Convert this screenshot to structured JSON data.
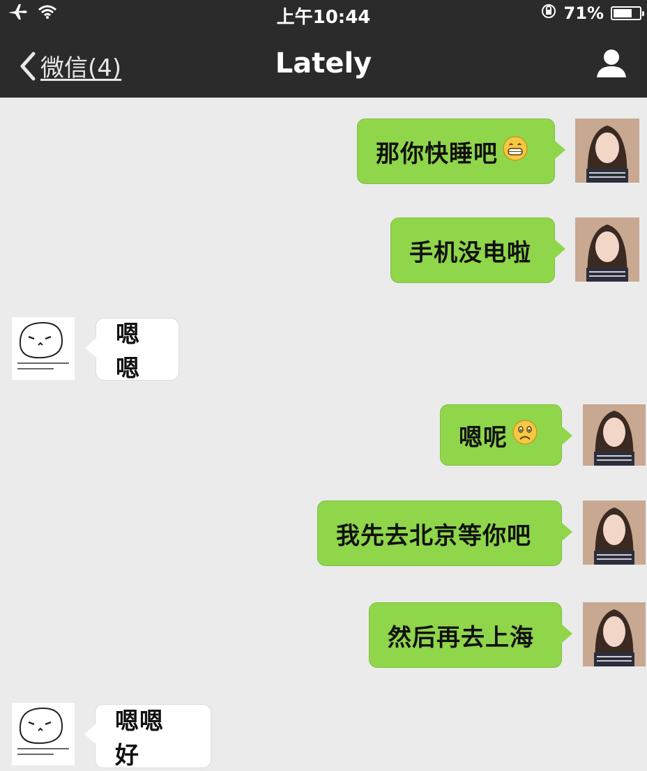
{
  "status_bar": {
    "time": "上午10:44",
    "battery_text": "71%",
    "battery_level": 0.71
  },
  "nav": {
    "back_label": "微信(4)",
    "title": "Lately",
    "icons": {
      "back": "chevron-left-icon",
      "profile": "person-icon"
    }
  },
  "colors": {
    "nav_bg": "#2b2b2b",
    "chat_bg": "#ebebeb",
    "outgoing_bubble": "#8fd64b",
    "incoming_bubble": "#ffffff"
  },
  "messages": [
    {
      "sender": "me",
      "text": "那你快睡吧",
      "emoji": "grin-emoji"
    },
    {
      "sender": "me",
      "text": "手机没电啦",
      "emoji": ""
    },
    {
      "sender": "contact",
      "text": "嗯嗯",
      "emoji": ""
    },
    {
      "sender": "me",
      "text": "嗯呢",
      "emoji": "sad-emoji"
    },
    {
      "sender": "me",
      "text": "我先去北京等你吧",
      "emoji": ""
    },
    {
      "sender": "me",
      "text": "然后再去上海",
      "emoji": ""
    },
    {
      "sender": "contact",
      "text": "嗯嗯 好",
      "emoji": ""
    }
  ]
}
